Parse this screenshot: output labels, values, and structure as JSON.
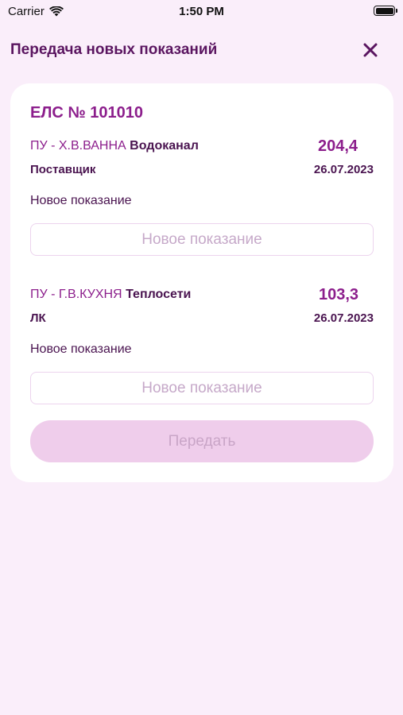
{
  "status_bar": {
    "carrier": "Carrier",
    "time": "1:50 PM"
  },
  "header": {
    "title": "Передача новых показаний"
  },
  "account": {
    "label": "ЕЛС № 101010"
  },
  "meters": [
    {
      "code": "ПУ - Х.В.ВАННА",
      "org": "Водоканал",
      "value": "204,4",
      "source": "Поставщик",
      "date": "26.07.2023",
      "field_label": "Новое показание",
      "placeholder": "Новое показание",
      "input_value": ""
    },
    {
      "code": "ПУ - Г.В.КУХНЯ",
      "org": "Теплосети",
      "value": "103,3",
      "source": "ЛК",
      "date": "26.07.2023",
      "field_label": "Новое показание",
      "placeholder": "Новое показание",
      "input_value": ""
    }
  ],
  "submit": {
    "label": "Передать",
    "enabled": false
  },
  "colors": {
    "background": "#faeefa",
    "accent": "#8c1e8c",
    "text": "#4a1450",
    "button_disabled": "#efcdeb"
  },
  "icons": {
    "close": "close-icon",
    "wifi": "wifi-icon",
    "battery": "battery-icon"
  }
}
